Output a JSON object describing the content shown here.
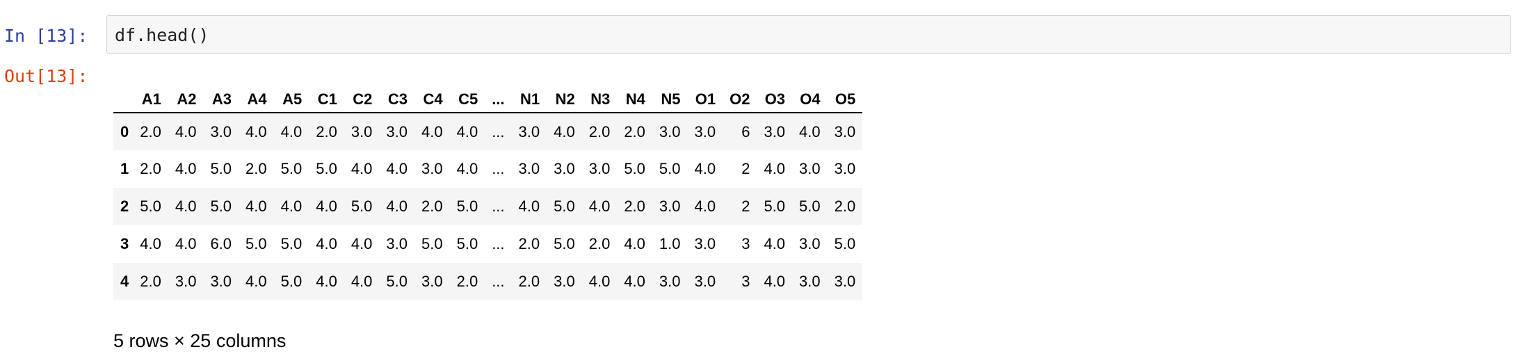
{
  "cell": {
    "in_prompt": "In [13]:",
    "out_prompt": "Out[13]:",
    "code": "df.head()"
  },
  "dataframe": {
    "columns": [
      "A1",
      "A2",
      "A3",
      "A4",
      "A5",
      "C1",
      "C2",
      "C3",
      "C4",
      "C5",
      "...",
      "N1",
      "N2",
      "N3",
      "N4",
      "N5",
      "O1",
      "O2",
      "O3",
      "O4",
      "O5"
    ],
    "rows": [
      {
        "index": "0",
        "cells": [
          "2.0",
          "4.0",
          "3.0",
          "4.0",
          "4.0",
          "2.0",
          "3.0",
          "3.0",
          "4.0",
          "4.0",
          "...",
          "3.0",
          "4.0",
          "2.0",
          "2.0",
          "3.0",
          "3.0",
          "6",
          "3.0",
          "4.0",
          "3.0"
        ]
      },
      {
        "index": "1",
        "cells": [
          "2.0",
          "4.0",
          "5.0",
          "2.0",
          "5.0",
          "5.0",
          "4.0",
          "4.0",
          "3.0",
          "4.0",
          "...",
          "3.0",
          "3.0",
          "3.0",
          "5.0",
          "5.0",
          "4.0",
          "2",
          "4.0",
          "3.0",
          "3.0"
        ]
      },
      {
        "index": "2",
        "cells": [
          "5.0",
          "4.0",
          "5.0",
          "4.0",
          "4.0",
          "4.0",
          "5.0",
          "4.0",
          "2.0",
          "5.0",
          "...",
          "4.0",
          "5.0",
          "4.0",
          "2.0",
          "3.0",
          "4.0",
          "2",
          "5.0",
          "5.0",
          "2.0"
        ]
      },
      {
        "index": "3",
        "cells": [
          "4.0",
          "4.0",
          "6.0",
          "5.0",
          "5.0",
          "4.0",
          "4.0",
          "3.0",
          "5.0",
          "5.0",
          "...",
          "2.0",
          "5.0",
          "2.0",
          "4.0",
          "1.0",
          "3.0",
          "3",
          "4.0",
          "3.0",
          "5.0"
        ]
      },
      {
        "index": "4",
        "cells": [
          "2.0",
          "3.0",
          "3.0",
          "4.0",
          "5.0",
          "4.0",
          "4.0",
          "5.0",
          "3.0",
          "2.0",
          "...",
          "2.0",
          "3.0",
          "4.0",
          "4.0",
          "3.0",
          "3.0",
          "3",
          "4.0",
          "3.0",
          "3.0"
        ]
      }
    ],
    "shape_caption": "5 rows × 25 columns"
  }
}
